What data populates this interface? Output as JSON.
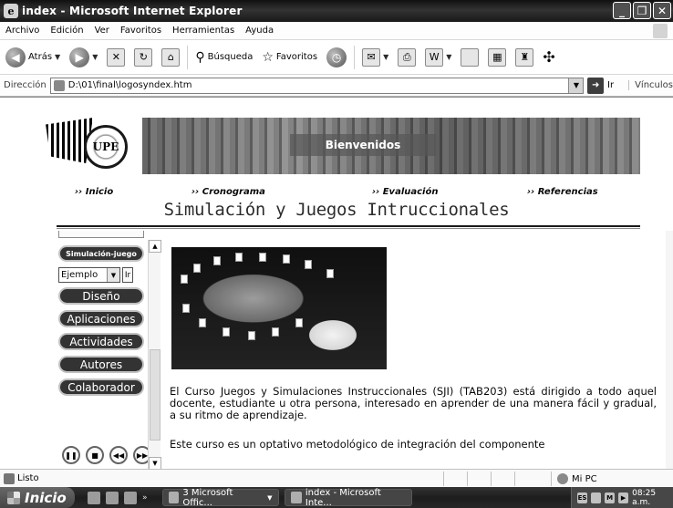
{
  "window": {
    "title": "index - Microsoft Internet Explorer"
  },
  "menu": [
    "Archivo",
    "Edición",
    "Ver",
    "Favoritos",
    "Herramientas",
    "Ayuda"
  ],
  "toolbar": {
    "back_label": "Atrás",
    "search_label": "Búsqueda",
    "favorites_label": "Favoritos"
  },
  "address": {
    "label": "Dirección",
    "value": "D:\\01\\final\\logosyndex.htm",
    "go_label": "Ir",
    "links_label": "Vínculos"
  },
  "page": {
    "banner_text": "Bienvenidos",
    "logo_text": "UPE",
    "nav": [
      "›› Inicio",
      "›› Cronograma",
      "›› Evaluación",
      "›› Referencias"
    ],
    "title": "Simulación y Juegos Intruccionales",
    "sidebar": {
      "top_button": "Simulación-juego",
      "select_value": "Ejemplo",
      "select_button": "Ir",
      "buttons": [
        "Diseño",
        "Aplicaciones",
        "Actividades",
        "Autores",
        "Colaborador"
      ]
    },
    "paragraphs": [
      "El Curso Juegos y Simulaciones Instruccionales (SJI) (TAB203) está dirigido a todo aquel docente, estudiante u otra persona, interesado en aprender de una manera fácil y gradual, a su ritmo de aprendizaje.",
      "Este curso es un optativo metodológico de integración del componente"
    ]
  },
  "status": {
    "text": "Listo",
    "zone": "Mi PC"
  },
  "taskbar": {
    "start_label": "Inicio",
    "more_label": "»",
    "tasks": [
      "3 Microsoft Offic...",
      "index - Microsoft Inte..."
    ],
    "clock": "08:25 a.m."
  }
}
